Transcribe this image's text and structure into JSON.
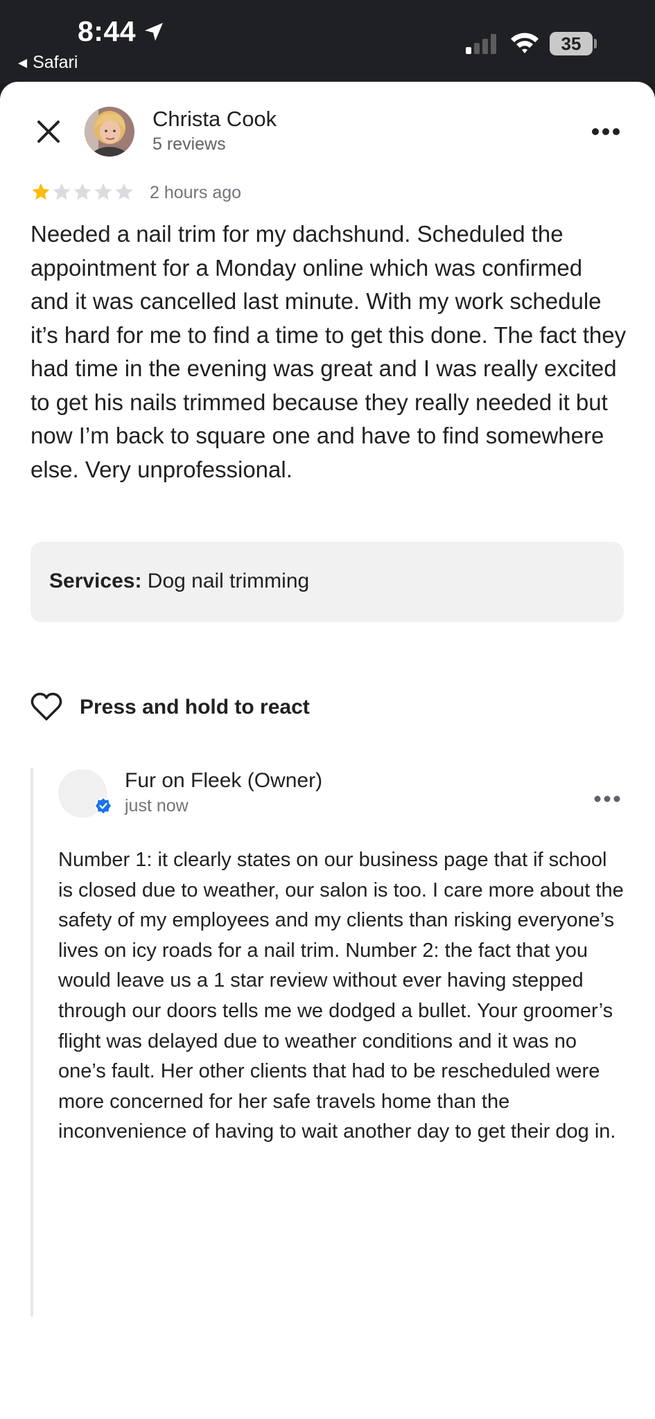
{
  "status_bar": {
    "time": "8:44",
    "back_app": "Safari",
    "battery": "35",
    "icons": [
      "location-arrow-icon",
      "cellular-signal-icon",
      "wifi-icon",
      "battery-icon"
    ]
  },
  "review": {
    "reviewer_name": "Christa Cook",
    "review_count": "5 reviews",
    "rating": 1,
    "max_rating": 5,
    "star_color": "#fbbc04",
    "time_ago": "2 hours ago",
    "text": "Needed a nail trim for my dachshund. Scheduled the appointment for a Monday online which was confirmed and it was cancelled last minute. With my work schedule it’s hard for me to find a time to get this done. The fact they had time in the evening was great and I was really excited to get his nails trimmed because they really needed it but now I’m back to square one and have to find somewhere else. Very unprofessional.",
    "services_label": "Services:",
    "services_value": "Dog nail trimming",
    "react_label": "Press and hold to react"
  },
  "owner_reply": {
    "name": "Fur on Fleek (Owner)",
    "time_ago": "just now",
    "verified_color": "#1a73e8",
    "text": "Number 1: it clearly states on our business page that if school is closed due to weather, our salon is too. I care more about the safety of my employees and my clients than risking everyone’s lives on icy roads for a nail trim. Number 2: the fact that you would leave us a 1 star review without ever having stepped through our doors tells me we dodged a bullet. Your groomer’s flight was delayed due to weather conditions and it was no one’s fault. Her other clients that had to be rescheduled were more concerned for her safe travels home than the inconvenience of having to wait another day to get their dog in."
  }
}
